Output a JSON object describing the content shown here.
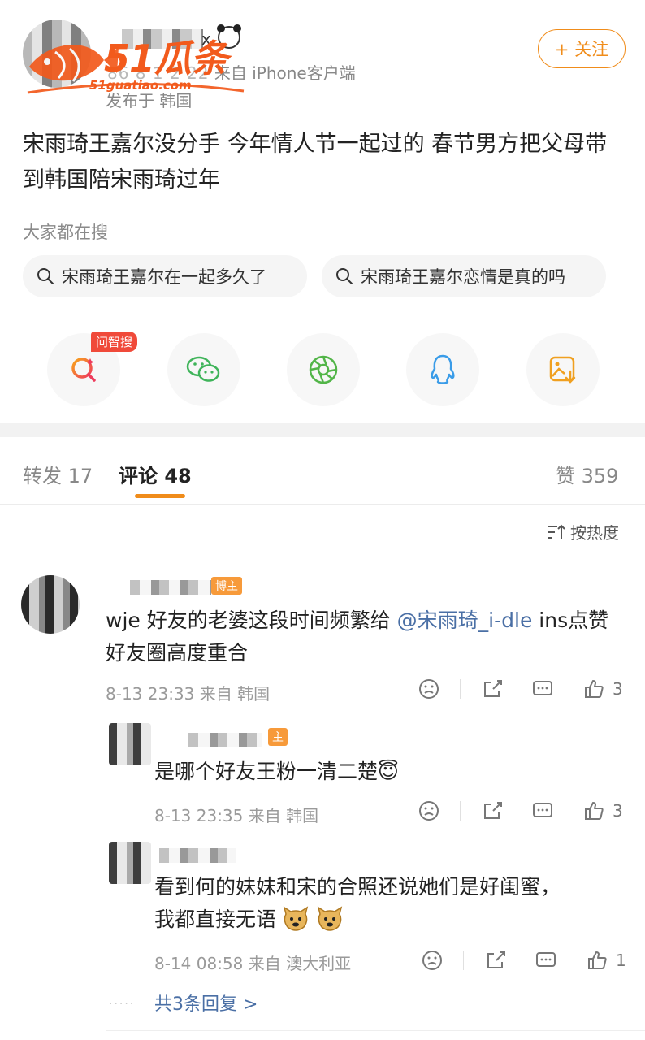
{
  "header": {
    "name_suffix": "x",
    "time_blurred": "86 8 1 2 22",
    "source": "来自 iPhone客户端",
    "posted_from": "发布于 韩国",
    "follow_label": "+ 关注"
  },
  "watermark": {
    "brand": "51瓜条",
    "url": "51guatiao.com"
  },
  "post": {
    "text": "宋雨琦王嘉尔没分手 今年情人节一起过的 春节男方把父母带到韩国陪宋雨琦过年"
  },
  "search": {
    "label": "大家都在搜",
    "chips": [
      "宋雨琦王嘉尔在一起多久了",
      "宋雨琦王嘉尔恋情是真的吗"
    ]
  },
  "share": {
    "badge": "问智搜",
    "icons": [
      "search-ai-icon",
      "wechat-icon",
      "moments-icon",
      "qq-icon",
      "save-image-icon"
    ]
  },
  "tabs": {
    "repost": "转发 17",
    "comments": "评论 48",
    "likes": "赞 359"
  },
  "sort_label": "按热度",
  "comments": [
    {
      "tag": "博主",
      "text_pre": "wje 好友的老婆这段时间频繁给 ",
      "mention": "@宋雨琦_i-dle",
      "text_post": " ins点赞  好友圈高度重合",
      "meta": "8-13 23:33  来自 韩国",
      "likes": "3"
    },
    {
      "tag": "主",
      "text": "是哪个好友王粉一清二楚😇",
      "meta": "8-13 23:35  来自 韩国",
      "likes": "3"
    },
    {
      "text_line1": "看到何的妹妹和宋的合照还说她们是好闺蜜，",
      "text_line2": "我都直接无语",
      "meta": "8-14 08:58  来自 澳大利亚",
      "likes": "1"
    }
  ],
  "more_replies": "共3条回复 >",
  "colors": {
    "accent": "#f08c1a",
    "link": "#4a6fa5",
    "watermark": "#f25a1c"
  }
}
